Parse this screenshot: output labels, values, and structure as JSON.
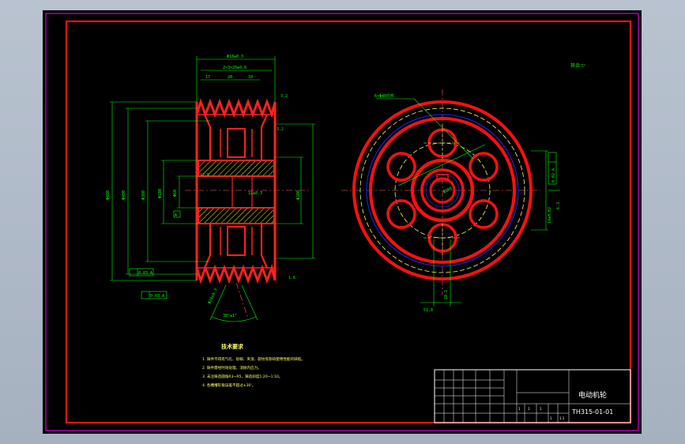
{
  "title_block": {
    "part_name": "电动机轮",
    "drawing_number": "TH315-01-01",
    "tiny_cells": [
      "1",
      "1",
      "1",
      "1:1",
      "1"
    ]
  },
  "technical_requirements": {
    "heading": "技术要求",
    "items": [
      "1. 铸件不得有气孔、砂眼、夹渣、裂纹等影响使用性能的缺陷。",
      "2. 铸件需经时效处理，消除内应力。",
      "3. 未注铸造圆角R3~R5，铸造斜度1:20~1:10。",
      "4. 各槽槽形角误差不超过±30'。"
    ]
  },
  "side_view": {
    "dims_top": [
      "Φ18±0.3",
      "2×3×20±0.6",
      "17",
      "20",
      "10"
    ],
    "dims_vertical": [
      "Φ480",
      "Φ400",
      "Φ380",
      "Φ180",
      "Φ60",
      "Φ380"
    ],
    "roughness": [
      "3.2",
      "1.6",
      "12.5",
      "3.2"
    ],
    "keyway_label": "12±0.3",
    "groove_angle": "38°±1°",
    "groove_dim": "Φ28±0.3",
    "datum": "A",
    "gdt": [
      "0.03 A",
      "0.03 A"
    ]
  },
  "front_view": {
    "holes_label": "6×Φ40均布",
    "dims": [
      "Φ280",
      "51.8",
      "10.2"
    ],
    "gdt": "0.02 A",
    "key_dim": "14±0.02",
    "roughness_right": "6.3"
  },
  "surface_note": "其余 ▽"
}
